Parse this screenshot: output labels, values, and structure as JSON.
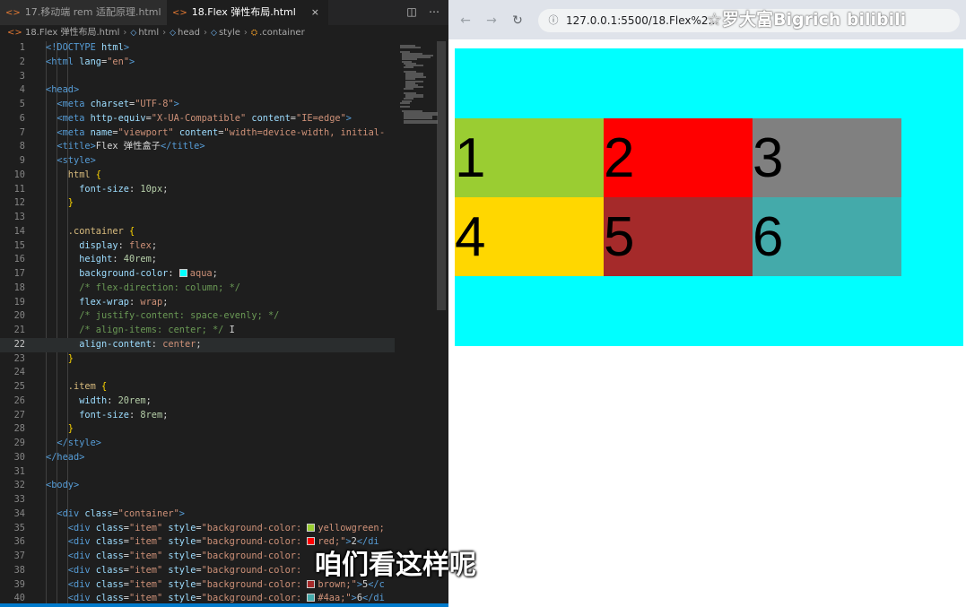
{
  "editor": {
    "tabs": [
      {
        "label": "17.移动端 rem 适配原理.html",
        "active": false
      },
      {
        "label": "18.Flex 弹性布局.html",
        "active": true
      }
    ],
    "tab_close_glyph": "×",
    "breadcrumb": [
      "18.Flex 弹性布局.html",
      "html",
      "head",
      "style",
      ".container"
    ],
    "current_line": 22,
    "lines": [
      {
        "n": 1,
        "indent": 0,
        "tokens": [
          [
            "tag",
            "<!DOCTYPE "
          ],
          [
            "attr",
            "html"
          ],
          [
            "tag",
            ">"
          ]
        ]
      },
      {
        "n": 2,
        "indent": 0,
        "tokens": [
          [
            "tag",
            "<html "
          ],
          [
            "attr",
            "lang"
          ],
          [
            "txt",
            "="
          ],
          [
            "str",
            "\"en\""
          ],
          [
            "tag",
            ">"
          ]
        ]
      },
      {
        "n": 3,
        "indent": 0,
        "tokens": []
      },
      {
        "n": 4,
        "indent": 0,
        "tokens": [
          [
            "tag",
            "<head>"
          ]
        ]
      },
      {
        "n": 5,
        "indent": 1,
        "tokens": [
          [
            "tag",
            "<meta "
          ],
          [
            "attr",
            "charset"
          ],
          [
            "txt",
            "="
          ],
          [
            "str",
            "\"UTF-8\""
          ],
          [
            "tag",
            ">"
          ]
        ]
      },
      {
        "n": 6,
        "indent": 1,
        "tokens": [
          [
            "tag",
            "<meta "
          ],
          [
            "attr",
            "http-equiv"
          ],
          [
            "txt",
            "="
          ],
          [
            "str",
            "\"X-UA-Compatible\""
          ],
          [
            "txt",
            " "
          ],
          [
            "attr",
            "content"
          ],
          [
            "txt",
            "="
          ],
          [
            "str",
            "\"IE=edge\""
          ],
          [
            "tag",
            ">"
          ]
        ]
      },
      {
        "n": 7,
        "indent": 1,
        "tokens": [
          [
            "tag",
            "<meta "
          ],
          [
            "attr",
            "name"
          ],
          [
            "txt",
            "="
          ],
          [
            "str",
            "\"viewport\""
          ],
          [
            "txt",
            " "
          ],
          [
            "attr",
            "content"
          ],
          [
            "txt",
            "="
          ],
          [
            "str",
            "\"width=device-width, initial-"
          ]
        ]
      },
      {
        "n": 8,
        "indent": 1,
        "tokens": [
          [
            "tag",
            "<title>"
          ],
          [
            "txt",
            "Flex 弹性盒子"
          ],
          [
            "tag",
            "</title>"
          ]
        ]
      },
      {
        "n": 9,
        "indent": 1,
        "tokens": [
          [
            "tag",
            "<style>"
          ]
        ]
      },
      {
        "n": 10,
        "indent": 2,
        "tokens": [
          [
            "sel",
            "html "
          ],
          [
            "brace",
            "{"
          ]
        ]
      },
      {
        "n": 11,
        "indent": 3,
        "tokens": [
          [
            "prop",
            "font-size"
          ],
          [
            "txt",
            ": "
          ],
          [
            "num",
            "10px"
          ],
          [
            "txt",
            ";"
          ]
        ]
      },
      {
        "n": 12,
        "indent": 2,
        "tokens": [
          [
            "brace",
            "}"
          ]
        ]
      },
      {
        "n": 13,
        "indent": 0,
        "tokens": []
      },
      {
        "n": 14,
        "indent": 2,
        "tokens": [
          [
            "sel",
            ".container "
          ],
          [
            "brace",
            "{"
          ]
        ]
      },
      {
        "n": 15,
        "indent": 3,
        "tokens": [
          [
            "prop",
            "display"
          ],
          [
            "txt",
            ": "
          ],
          [
            "val",
            "flex"
          ],
          [
            "txt",
            ";"
          ]
        ]
      },
      {
        "n": 16,
        "indent": 3,
        "tokens": [
          [
            "prop",
            "height"
          ],
          [
            "txt",
            ": "
          ],
          [
            "num",
            "40rem"
          ],
          [
            "txt",
            ";"
          ]
        ]
      },
      {
        "n": 17,
        "indent": 3,
        "tokens": [
          [
            "prop",
            "background-color"
          ],
          [
            "txt",
            ": "
          ],
          [
            "swatch",
            "#00ffff"
          ],
          [
            "val",
            "aqua"
          ],
          [
            "txt",
            ";"
          ]
        ]
      },
      {
        "n": 18,
        "indent": 3,
        "tokens": [
          [
            "com",
            "/* flex-direction: column; */"
          ]
        ]
      },
      {
        "n": 19,
        "indent": 3,
        "tokens": [
          [
            "prop",
            "flex-wrap"
          ],
          [
            "txt",
            ": "
          ],
          [
            "val",
            "wrap"
          ],
          [
            "txt",
            ";"
          ]
        ]
      },
      {
        "n": 20,
        "indent": 3,
        "tokens": [
          [
            "com",
            "/* justify-content: space-evenly; */"
          ]
        ]
      },
      {
        "n": 21,
        "indent": 3,
        "tokens": [
          [
            "com",
            "/* align-items: center; */"
          ],
          [
            "txt",
            " I"
          ]
        ]
      },
      {
        "n": 22,
        "indent": 3,
        "tokens": [
          [
            "prop",
            "align-content"
          ],
          [
            "txt",
            ": "
          ],
          [
            "val",
            "center"
          ],
          [
            "txt",
            ";"
          ]
        ]
      },
      {
        "n": 23,
        "indent": 2,
        "tokens": [
          [
            "brace",
            "}"
          ]
        ]
      },
      {
        "n": 24,
        "indent": 0,
        "tokens": []
      },
      {
        "n": 25,
        "indent": 2,
        "tokens": [
          [
            "sel",
            ".item "
          ],
          [
            "brace",
            "{"
          ]
        ]
      },
      {
        "n": 26,
        "indent": 3,
        "tokens": [
          [
            "prop",
            "width"
          ],
          [
            "txt",
            ": "
          ],
          [
            "num",
            "20rem"
          ],
          [
            "txt",
            ";"
          ]
        ]
      },
      {
        "n": 27,
        "indent": 3,
        "tokens": [
          [
            "prop",
            "font-size"
          ],
          [
            "txt",
            ": "
          ],
          [
            "num",
            "8rem"
          ],
          [
            "txt",
            ";"
          ]
        ]
      },
      {
        "n": 28,
        "indent": 2,
        "tokens": [
          [
            "brace",
            "}"
          ]
        ]
      },
      {
        "n": 29,
        "indent": 1,
        "tokens": [
          [
            "tag",
            "</style>"
          ]
        ]
      },
      {
        "n": 30,
        "indent": 0,
        "tokens": [
          [
            "tag",
            "</head>"
          ]
        ]
      },
      {
        "n": 31,
        "indent": 0,
        "tokens": []
      },
      {
        "n": 32,
        "indent": 0,
        "tokens": [
          [
            "tag",
            "<body>"
          ]
        ]
      },
      {
        "n": 33,
        "indent": 0,
        "tokens": []
      },
      {
        "n": 34,
        "indent": 1,
        "tokens": [
          [
            "tag",
            "<div "
          ],
          [
            "attr",
            "class"
          ],
          [
            "txt",
            "="
          ],
          [
            "str",
            "\"container\""
          ],
          [
            "tag",
            ">"
          ]
        ]
      },
      {
        "n": 35,
        "indent": 2,
        "tokens": [
          [
            "tag",
            "<div "
          ],
          [
            "attr",
            "class"
          ],
          [
            "txt",
            "="
          ],
          [
            "str",
            "\"item\""
          ],
          [
            "txt",
            " "
          ],
          [
            "attr",
            "style"
          ],
          [
            "txt",
            "="
          ],
          [
            "str",
            "\"background-color: "
          ],
          [
            "swatch",
            "#9acd32"
          ],
          [
            "str",
            "yellowgreen;"
          ]
        ]
      },
      {
        "n": 36,
        "indent": 2,
        "tokens": [
          [
            "tag",
            "<div "
          ],
          [
            "attr",
            "class"
          ],
          [
            "txt",
            "="
          ],
          [
            "str",
            "\"item\""
          ],
          [
            "txt",
            " "
          ],
          [
            "attr",
            "style"
          ],
          [
            "txt",
            "="
          ],
          [
            "str",
            "\"background-color: "
          ],
          [
            "swatch",
            "#ff0000"
          ],
          [
            "str",
            "red;\""
          ],
          [
            "tag",
            ">"
          ],
          [
            "txt",
            "2"
          ],
          [
            "tag",
            "</di"
          ]
        ]
      },
      {
        "n": 37,
        "indent": 2,
        "tokens": [
          [
            "tag",
            "<div "
          ],
          [
            "attr",
            "class"
          ],
          [
            "txt",
            "="
          ],
          [
            "str",
            "\"item\""
          ],
          [
            "txt",
            " "
          ],
          [
            "attr",
            "style"
          ],
          [
            "txt",
            "="
          ],
          [
            "str",
            "\"background-color: "
          ]
        ]
      },
      {
        "n": 38,
        "indent": 2,
        "tokens": [
          [
            "tag",
            "<div "
          ],
          [
            "attr",
            "class"
          ],
          [
            "txt",
            "="
          ],
          [
            "str",
            "\"item\""
          ],
          [
            "txt",
            " "
          ],
          [
            "attr",
            "style"
          ],
          [
            "txt",
            "="
          ],
          [
            "str",
            "\"background-color: "
          ]
        ]
      },
      {
        "n": 39,
        "indent": 2,
        "tokens": [
          [
            "tag",
            "<div "
          ],
          [
            "attr",
            "class"
          ],
          [
            "txt",
            "="
          ],
          [
            "str",
            "\"item\""
          ],
          [
            "txt",
            " "
          ],
          [
            "attr",
            "style"
          ],
          [
            "txt",
            "="
          ],
          [
            "str",
            "\"background-color: "
          ],
          [
            "swatch",
            "#a52a2a"
          ],
          [
            "str",
            "brown;\""
          ],
          [
            "tag",
            ">"
          ],
          [
            "txt",
            "5"
          ],
          [
            "tag",
            "</c"
          ]
        ]
      },
      {
        "n": 40,
        "indent": 2,
        "tokens": [
          [
            "tag",
            "<div "
          ],
          [
            "attr",
            "class"
          ],
          [
            "txt",
            "="
          ],
          [
            "str",
            "\"item\""
          ],
          [
            "txt",
            " "
          ],
          [
            "attr",
            "style"
          ],
          [
            "txt",
            "="
          ],
          [
            "str",
            "\"background-color: "
          ],
          [
            "swatch",
            "#44aaaa"
          ],
          [
            "str",
            "#4aa;\""
          ],
          [
            "tag",
            ">"
          ],
          [
            "txt",
            "6"
          ],
          [
            "tag",
            "</di"
          ]
        ]
      }
    ]
  },
  "browser": {
    "nav": {
      "back": "←",
      "forward": "→",
      "reload": "↻",
      "info": "ⓘ"
    },
    "url": "127.0.0.1:5500/18.Flex%2...",
    "watermark": "☆罗大富Bigrich bilibili",
    "container_color": "#00ffff",
    "items": [
      {
        "label": "1",
        "color": "#9acd32"
      },
      {
        "label": "2",
        "color": "#ff0000"
      },
      {
        "label": "3",
        "color": "#808080"
      },
      {
        "label": "4",
        "color": "#ffd700"
      },
      {
        "label": "5",
        "color": "#a52a2a"
      },
      {
        "label": "6",
        "color": "#44aaaa"
      }
    ]
  },
  "subtitle": "咱们看这样呢"
}
